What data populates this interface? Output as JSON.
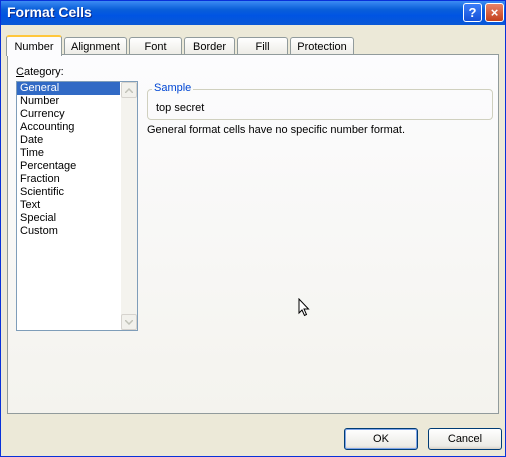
{
  "window": {
    "title": "Format Cells",
    "help_glyph": "?",
    "close_glyph": "×"
  },
  "tabs": [
    {
      "label": "Number",
      "active": true
    },
    {
      "label": "Alignment",
      "active": false
    },
    {
      "label": "Font",
      "active": false
    },
    {
      "label": "Border",
      "active": false
    },
    {
      "label": "Fill",
      "active": false
    },
    {
      "label": "Protection",
      "active": false
    }
  ],
  "category": {
    "label_prefix": "C",
    "label_rest": "ategory:",
    "items": [
      "General",
      "Number",
      "Currency",
      "Accounting",
      "Date",
      "Time",
      "Percentage",
      "Fraction",
      "Scientific",
      "Text",
      "Special",
      "Custom"
    ],
    "selected": "General"
  },
  "sample": {
    "legend": "Sample",
    "value": "top secret"
  },
  "description": "General format cells have no specific number format.",
  "buttons": {
    "ok": "OK",
    "cancel": "Cancel"
  },
  "colors": {
    "titlebar": "#0054e3",
    "selection": "#316ac5",
    "dialog_bg": "#ece9d8",
    "group_legend": "#0046d5"
  },
  "icons": {
    "help": "help-icon",
    "close": "close-icon",
    "scroll_up": "chevron-up-icon",
    "scroll_down": "chevron-down-icon",
    "cursor": "mouse-pointer-icon"
  }
}
